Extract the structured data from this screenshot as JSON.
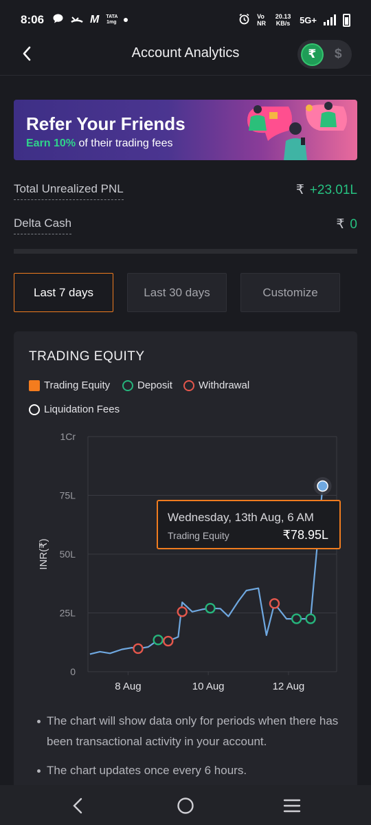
{
  "status_bar": {
    "time": "8:06",
    "icons": [
      "chat-icon",
      "missed-call-icon",
      "m-app-icon",
      "tata-1mg-icon",
      "dot-icon"
    ],
    "m_glyph": "M",
    "tata_glyph": "TATA 1mg",
    "network": "Vo NR",
    "speed": "20.13 KB/s",
    "network_type": "5G+"
  },
  "header": {
    "title": "Account Analytics",
    "currency_inr": "₹",
    "currency_usd": "$"
  },
  "banner": {
    "title": "Refer Your Friends",
    "highlight": "Earn 10%",
    "subtitle": " of their trading fees"
  },
  "pnl": {
    "unrealized_label": "Total Unrealized PNL",
    "unrealized_currency": "₹",
    "unrealized_value": "+23.01L",
    "delta_label": "Delta Cash",
    "delta_currency": "₹",
    "delta_value": "0"
  },
  "period_tabs": [
    {
      "label": "Last 7 days",
      "active": true
    },
    {
      "label": "Last 30 days",
      "active": false
    },
    {
      "label": "Customize",
      "active": false
    }
  ],
  "card": {
    "title": "TRADING EQUITY",
    "legend": [
      {
        "label": "Trading Equity",
        "color": "#f47c1e",
        "shape": "square"
      },
      {
        "label": "Deposit",
        "color": "#26b57c",
        "shape": "circle"
      },
      {
        "label": "Withdrawal",
        "color": "#e5574c",
        "shape": "circle"
      },
      {
        "label": "Liquidation Fees",
        "color": "#ffffff",
        "shape": "circle"
      }
    ],
    "tooltip": {
      "date": "Wednesday, 13th Aug, 6 AM",
      "label": "Trading Equity",
      "value": "₹78.95L"
    },
    "notes": [
      "The chart will show data only for periods when there has been transactional activity in your account.",
      "The chart updates once every 6 hours."
    ]
  },
  "chart_data": {
    "type": "line",
    "title": "",
    "ylabel": "INR(₹)",
    "ylim": [
      0,
      100
    ],
    "y_ticks": [
      {
        "label": "0",
        "value": 0
      },
      {
        "label": "25L",
        "value": 25
      },
      {
        "label": "50L",
        "value": 50
      },
      {
        "label": "75L",
        "value": 75
      },
      {
        "label": "1Cr",
        "value": 100
      }
    ],
    "x_ticks": [
      {
        "label": "8 Aug",
        "value": 8
      },
      {
        "label": "10 Aug",
        "value": 10
      },
      {
        "label": "12 Aug",
        "value": 12
      }
    ],
    "xlim": [
      7.0,
      13.2
    ],
    "series": [
      {
        "name": "Trading Equity",
        "color": "#6fa8e0",
        "x": [
          7.05,
          7.3,
          7.55,
          7.85,
          8.1,
          8.25,
          8.5,
          8.75,
          9.0,
          9.25,
          9.35,
          9.6,
          9.85,
          10.05,
          10.3,
          10.5,
          10.75,
          10.95,
          11.25,
          11.45,
          11.65,
          11.95,
          12.2,
          12.35,
          12.55,
          12.85,
          13.0
        ],
        "y": [
          7.5,
          8.5,
          7.8,
          9.5,
          10.2,
          9.8,
          10.5,
          13.5,
          13.0,
          14.8,
          29.5,
          25.5,
          26.5,
          27.0,
          26.8,
          23.5,
          30.0,
          34.5,
          35.5,
          15.5,
          29.0,
          22.5,
          22.5,
          22.5,
          22.5,
          78.95,
          79.0
        ]
      }
    ],
    "markers": [
      {
        "type": "withdrawal",
        "x": 8.25,
        "y": 9.8
      },
      {
        "type": "deposit",
        "x": 8.75,
        "y": 13.5
      },
      {
        "type": "withdrawal",
        "x": 9.0,
        "y": 13.0
      },
      {
        "type": "withdrawal",
        "x": 9.35,
        "y": 25.5
      },
      {
        "type": "deposit",
        "x": 10.05,
        "y": 27.0
      },
      {
        "type": "withdrawal",
        "x": 11.65,
        "y": 29.0
      },
      {
        "type": "deposit",
        "x": 12.2,
        "y": 22.5
      },
      {
        "type": "deposit",
        "x": 12.55,
        "y": 22.5
      }
    ],
    "highlight": {
      "x": 12.85,
      "y": 78.95
    },
    "grid": true
  },
  "nav": {
    "back": "back-nav-icon",
    "home": "home-nav-icon",
    "menu": "menu-nav-icon"
  }
}
